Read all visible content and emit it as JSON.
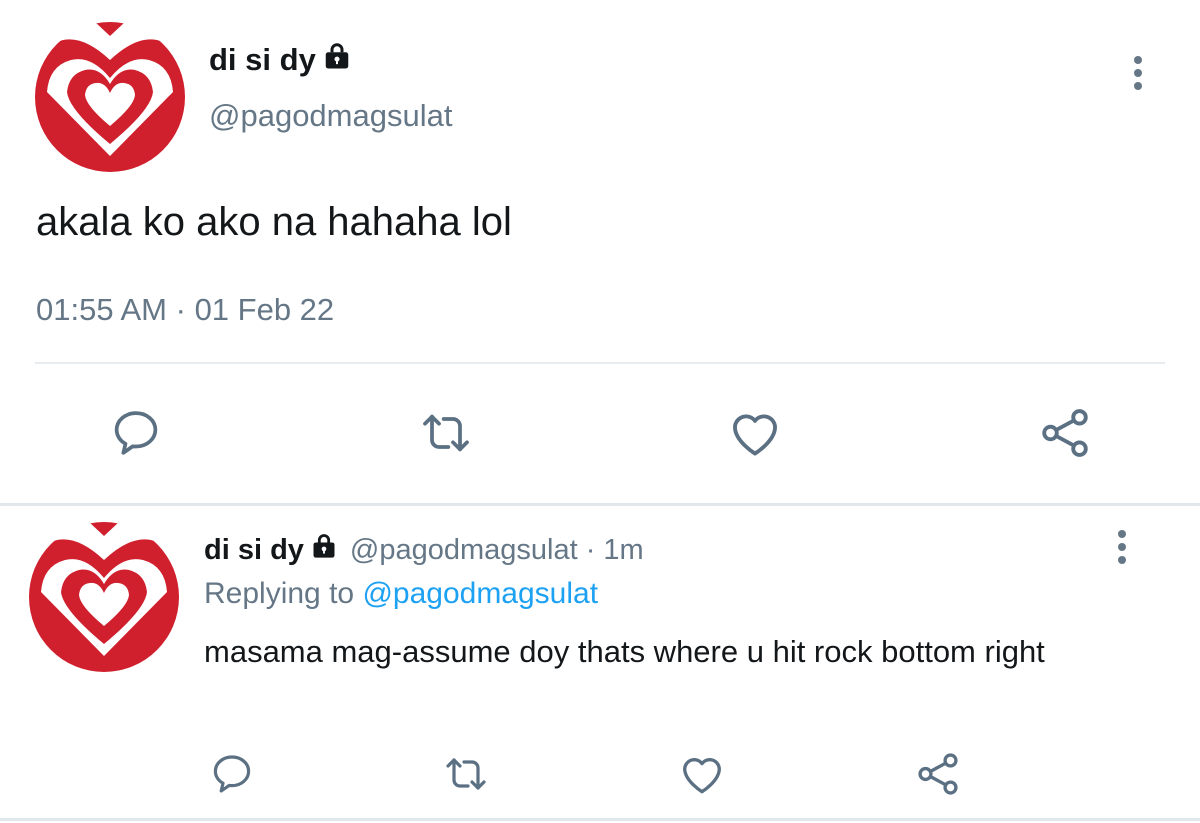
{
  "main_tweet": {
    "author": {
      "name": "di si dy",
      "handle": "@pagodmagsulat"
    },
    "text": "akala ko ako na hahaha lol",
    "time": "01:55 AM",
    "separator": "·",
    "date": "01 Feb 22"
  },
  "reply_tweet": {
    "author": {
      "name": "di si dy",
      "handle": "@pagodmagsulat"
    },
    "separator": "·",
    "age": "1m",
    "replying_prefix": "Replying to",
    "replying_to": "@pagodmagsulat",
    "text": "masama mag-assume doy thats where u hit rock bottom right"
  },
  "icons": {
    "avatar": "red-heart-chevron-logo",
    "lock": "lock-icon",
    "more": "vertical-ellipsis-icon",
    "actions": [
      "comment-icon",
      "retweet-icon",
      "heart-icon",
      "share-icon"
    ]
  },
  "colors": {
    "text": "#14171a",
    "secondary": "#657786",
    "link": "#1da1f2",
    "avatar_red": "#d0202e",
    "icon_gray": "#5b7083",
    "divider": "#e6ecf0"
  }
}
